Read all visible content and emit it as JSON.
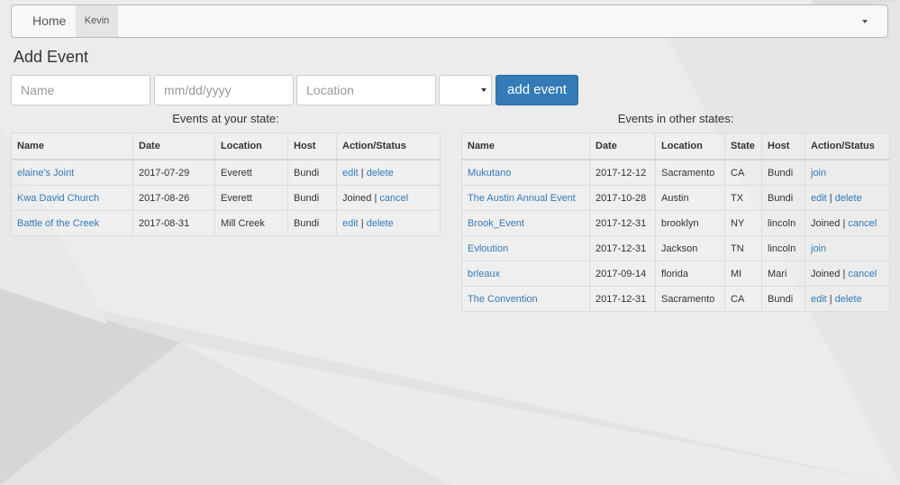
{
  "nav": {
    "home": "Home",
    "user": "Kevin"
  },
  "page_title": "Add Event",
  "form": {
    "name_placeholder": "Name",
    "date_placeholder": "mm/dd/yyyy",
    "location_placeholder": "Location",
    "state_value": "",
    "submit_label": "add event"
  },
  "local": {
    "caption": "Events at your state:",
    "headers": [
      "Name",
      "Date",
      "Location",
      "Host",
      "Action/Status"
    ],
    "rows": [
      {
        "name": "elaine's Joint",
        "date": "2017-07-29",
        "location": "Everett",
        "host": "Bundi",
        "status": "",
        "actions": [
          "edit",
          "delete"
        ]
      },
      {
        "name": "Kwa David Church",
        "date": "2017-08-26",
        "location": "Everett",
        "host": "Bundi",
        "status": "Joined",
        "actions": [
          "cancel"
        ]
      },
      {
        "name": "Battle of the Creek",
        "date": "2017-08-31",
        "location": "Mill Creek",
        "host": "Bundi",
        "status": "",
        "actions": [
          "edit",
          "delete"
        ]
      }
    ]
  },
  "other": {
    "caption": "Events in other states:",
    "headers": [
      "Name",
      "Date",
      "Location",
      "State",
      "Host",
      "Action/Status"
    ],
    "rows": [
      {
        "name": "Mukutano",
        "date": "2017-12-12",
        "location": "Sacramento",
        "state": "CA",
        "host": "Bundi",
        "status": "",
        "actions": [
          "join"
        ]
      },
      {
        "name": "The Austin Annual Event",
        "date": "2017-10-28",
        "location": "Austin",
        "state": "TX",
        "host": "Bundi",
        "status": "",
        "actions": [
          "edit",
          "delete"
        ]
      },
      {
        "name": "Brook_Event",
        "date": "2017-12-31",
        "location": "brooklyn",
        "state": "NY",
        "host": "lincoln",
        "status": "Joined",
        "actions": [
          "cancel"
        ]
      },
      {
        "name": "Evloution",
        "date": "2017-12-31",
        "location": "Jackson",
        "state": "TN",
        "host": "lincoln",
        "status": "",
        "actions": [
          "join"
        ]
      },
      {
        "name": "brleaux",
        "date": "2017-09-14",
        "location": "florida",
        "state": "MI",
        "host": "Mari",
        "status": "Joined",
        "actions": [
          "cancel"
        ]
      },
      {
        "name": "The Convention",
        "date": "2017-12-31",
        "location": "Sacramento",
        "state": "CA",
        "host": "Bundi",
        "status": "",
        "actions": [
          "edit",
          "delete"
        ]
      }
    ]
  },
  "colors": {
    "link": "#337ab7",
    "button": "#337ab7",
    "background": "#ececec"
  }
}
